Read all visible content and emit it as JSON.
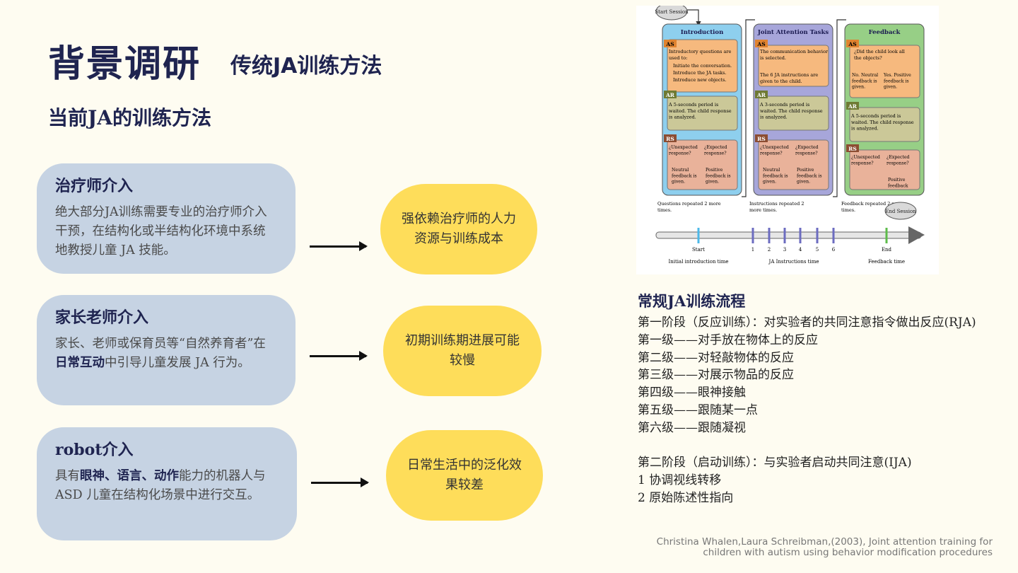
{
  "header": {
    "title": "背景调研",
    "subtitle": "传统JA训练方法",
    "section_heading": "当前JA的训练方法"
  },
  "cards": [
    {
      "title": "治疗师介入",
      "body_parts": [
        "绝大部分JA训练需要专业的治疗师介入干预，在结构化或半结构化环境中系统地教授儿童 JA 技能。"
      ],
      "outcome": "强依赖治疗师的人力资源与训练成本"
    },
    {
      "title": "家长老师介入",
      "body_parts": [
        "家长、老师或保育员等“自然养育者”在",
        "日常互动",
        "中引导儿童发展 JA 行为。"
      ],
      "outcome": "初期训练期进展可能较慢"
    },
    {
      "title": "robot介入",
      "body_parts": [
        "具有",
        "眼神、语言、动作",
        "能力的机器人与 ASD 儿童在结构化场景中进行交互。"
      ],
      "outcome": "日常生活中的泛化效果较差"
    }
  ],
  "diagram": {
    "start_session": "Start Session",
    "end_session": "End Session",
    "columns": [
      {
        "header": "Introduction",
        "color": "#8ecfee",
        "as": "Introductory questions are used to:",
        "as_bullets": [
          "Initiate the conversation.",
          "Introduce the JA tasks.",
          "Introduce new objects."
        ],
        "ar": "A 5-seconds period is waited. The child response is analyzed.",
        "rs_q1": "¿Unexpected response?",
        "rs_q2": "¿Expected response?",
        "rs_a1": "Neutral feedback is given.",
        "rs_a2": "Positive feedback is given.",
        "repeat": "Questions repeated 2 more times."
      },
      {
        "header": "Joint Attention Tasks",
        "color": "#a7a6da",
        "as": "The communication behavior is selected.",
        "as_note": "The 6 JA instructions are given to the child.",
        "ar": "A 3-seconds period is waited. The child response is analyzed.",
        "rs_q1": "¿Unexpected response?",
        "rs_q2": "¿Expected response?",
        "rs_a1": "Neutral feedback is given.",
        "rs_a2": "Positive feedback is given.",
        "repeat": "Instructions repeated 2 more times."
      },
      {
        "header": "Feedback",
        "color": "#97cf86",
        "as": "¿Did the child look all the objects?",
        "as_no": "No. Neutral feedback is given.",
        "as_yes": "Yes. Positive feedback is given.",
        "ar": "A 5-seconds period is waited. The child response is analyzed.",
        "rs_q1": "¿Unexpected response?",
        "rs_q2": "¿Expected response?",
        "rs_a2": "Positive feedback",
        "repeat": "Feedback repeated 2 more times."
      }
    ],
    "tags": {
      "as": "AS",
      "ar": "AR",
      "rs": "RS"
    },
    "timeline": {
      "start": "Start",
      "end": "End",
      "ticks": [
        "1",
        "2",
        "3",
        "4",
        "5",
        "6"
      ],
      "label_intro": "Initial introduction time",
      "label_ja": "JA Instructions time",
      "label_feedback": "Feedback time"
    }
  },
  "flow": {
    "title": "常规JA训练流程",
    "lines": [
      "第一阶段（反应训练）：对实验者的共同注意指令做出反应(RJA)",
      "第一级——对手放在物体上的反应",
      "第二级——对轻敲物体的反应",
      "第三级——对展示物品的反应",
      "第四级——眼神接触",
      "第五级——跟随某一点",
      "第六级——跟随凝视",
      "",
      "第二阶段（启动训练）：与实验者启动共同注意(IJA)",
      "1 协调视线转移",
      "2 原始陈述性指向"
    ]
  },
  "citation": {
    "line1": "Christina Whalen,Laura Schreibman,(2003), Joint attention training for",
    "line2": "children with autism using behavior modification procedures"
  }
}
